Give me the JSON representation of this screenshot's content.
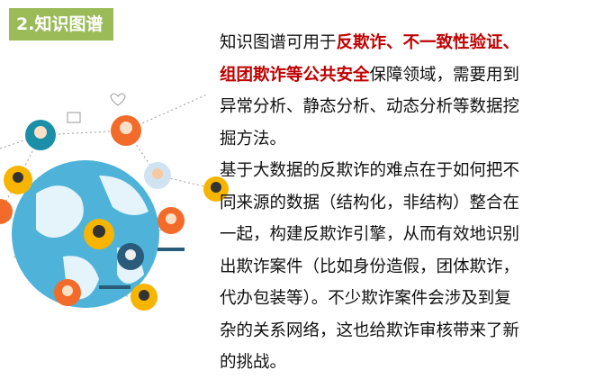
{
  "title": "2.知识图谱",
  "paragraph1": [
    [
      {
        "t": "知识图谱可用于",
        "hl": false
      },
      {
        "t": "反欺诈、不一致性验证、",
        "hl": true
      }
    ],
    [
      {
        "t": "组团欺诈等公共安全",
        "hl": true
      },
      {
        "t": "保障领域，需要用到",
        "hl": false
      }
    ],
    [
      {
        "t": "异常分析、静态分析、动态分析等数据挖",
        "hl": false
      }
    ],
    [
      {
        "t": "掘方法。",
        "hl": false
      }
    ]
  ],
  "paragraph2": [
    "基于大数据的反欺诈的难点在于如何把不",
    "同来源的数据（结构化，非结构）整合在",
    "一起，构建反欺诈引擎，从而有效地识别",
    "出欺诈案件（比如身份造假，团体欺诈，",
    "代办包装等）。不少欺诈案件会涉及到复",
    "杂的关系网络，这也给欺诈审核带来了新",
    "的挑战。"
  ],
  "colors": {
    "title_bg": "#9bbb59",
    "highlight": "#c00000",
    "globe": "#3aa0c8"
  }
}
